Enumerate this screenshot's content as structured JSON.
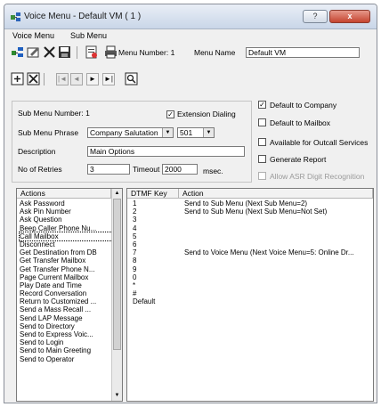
{
  "window": {
    "title": "Voice Menu - Default VM ( 1 )",
    "help_label": "?",
    "close_label": "x"
  },
  "menubar": {
    "items": [
      "Voice Menu",
      "Sub Menu"
    ]
  },
  "toolbar": {
    "menu_number_label": "Menu Number: 1",
    "menu_name_label": "Menu Name",
    "menu_name_value": "Default VM",
    "nav": [
      "|◄",
      "◄",
      "►",
      "►|"
    ]
  },
  "submenu": {
    "number_label": "Sub Menu Number: 1",
    "extension_dialing_label": "Extension Dialing",
    "extension_dialing_checked": true,
    "phrase_label": "Sub Menu Phrase",
    "phrase_value": "Company Salutation",
    "phrase_code": "501",
    "description_label": "Description",
    "description_value": "Main Options",
    "retries_label": "No of Retries",
    "retries_value": "3",
    "timeout_label": "Timeout",
    "timeout_value": "2000",
    "timeout_unit": "msec."
  },
  "options": [
    {
      "label": "Default to Company",
      "checked": true,
      "enabled": true
    },
    {
      "label": "Default to Mailbox",
      "checked": false,
      "enabled": true
    },
    {
      "label": "Available for Outcall Services",
      "checked": false,
      "enabled": true
    },
    {
      "label": "Generate Report",
      "checked": false,
      "enabled": true
    },
    {
      "label": "Allow ASR Digit Recognition",
      "checked": false,
      "enabled": false
    }
  ],
  "actions_list": {
    "header": "Actions",
    "items": [
      "Ask Password",
      "Ask Pin Number",
      "Ask Question",
      "Beep Caller Phone Nu...",
      "Call Mailbox",
      "Disconnect",
      "Get Destination from DB",
      "Get Transfer Mailbox",
      "Get Transfer Phone N...",
      "Page Current Mailbox",
      "Play Date and Time",
      "Record Conversation",
      "Return to Customized ...",
      "Send a Mass Recall ...",
      "Send LAP Message",
      "Send to Directory",
      "Send to Express Voic...",
      "Send to Login",
      "Send to Main Greeting",
      "Send to Operator"
    ],
    "selected": "Call Mailbox"
  },
  "dtmf_table": {
    "columns": [
      "DTMF Key",
      "Action"
    ],
    "keys": [
      "1",
      "2",
      "3",
      "4",
      "5",
      "6",
      "7",
      "8",
      "9",
      "0",
      "*",
      "#",
      "Default"
    ],
    "actions": [
      "Send to Sub Menu (Next Sub Menu=2)",
      "Send to Sub Menu (Next Sub Menu=Not Set)",
      "",
      "",
      "",
      "",
      "Send to Voice Menu (Next Voice Menu=5: Online Dr...",
      "",
      "",
      "",
      "",
      "",
      ""
    ]
  }
}
